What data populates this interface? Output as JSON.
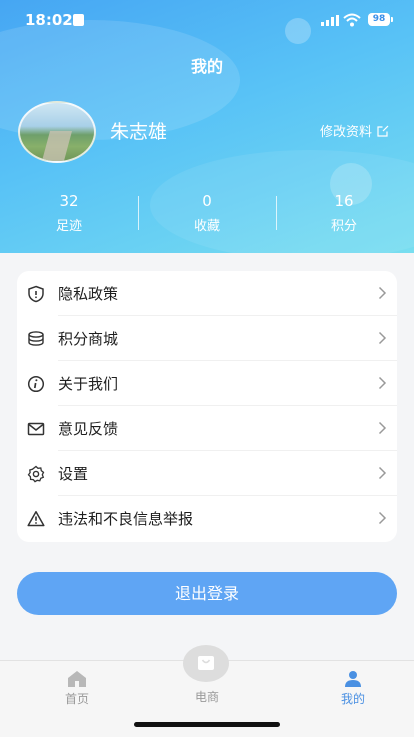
{
  "status_bar": {
    "time": "18:02",
    "battery": "98"
  },
  "page_title": "我的",
  "profile": {
    "name": "朱志雄",
    "edit_label": "修改资料"
  },
  "stats": [
    {
      "value": "32",
      "label": "足迹"
    },
    {
      "value": "0",
      "label": "收藏"
    },
    {
      "value": "16",
      "label": "积分"
    }
  ],
  "menu": [
    {
      "label": "隐私政策",
      "icon": "shield-icon"
    },
    {
      "label": "积分商城",
      "icon": "coins-icon"
    },
    {
      "label": "关于我们",
      "icon": "info-icon"
    },
    {
      "label": "意见反馈",
      "icon": "mail-icon"
    },
    {
      "label": "设置",
      "icon": "gear-icon"
    },
    {
      "label": "违法和不良信息举报",
      "icon": "warning-icon"
    }
  ],
  "logout_label": "退出登录",
  "tabs": [
    {
      "label": "首页",
      "icon": "home-icon"
    },
    {
      "label": "电商",
      "icon": "shop-bag-icon"
    },
    {
      "label": "我的",
      "icon": "person-icon"
    }
  ],
  "colors": {
    "accent": "#4a90e2",
    "logout": "#5fa5f4",
    "header_start": "#46a6f3",
    "header_end": "#78def0"
  }
}
